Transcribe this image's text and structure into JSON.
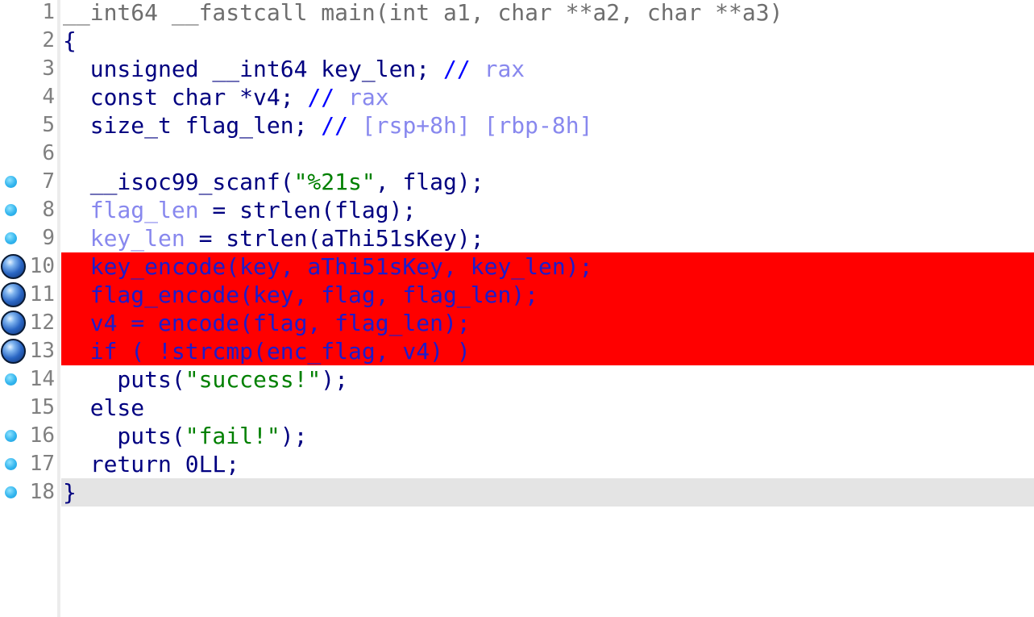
{
  "lines": [
    {
      "n": "1",
      "marker": "none",
      "state": "normal",
      "tokens": [
        {
          "t": "__int64 __fastcall main(int a1, char **a2, char **a3)",
          "c": "gray"
        }
      ]
    },
    {
      "n": "2",
      "marker": "none",
      "state": "normal",
      "tokens": [
        {
          "t": "{",
          "c": "navy"
        }
      ]
    },
    {
      "n": "3",
      "marker": "none",
      "state": "normal",
      "tokens": [
        {
          "t": "  unsigned __int64 key_len; ",
          "c": "navy"
        },
        {
          "t": "// ",
          "c": "blue"
        },
        {
          "t": "rax",
          "c": "light"
        }
      ]
    },
    {
      "n": "4",
      "marker": "none",
      "state": "normal",
      "tokens": [
        {
          "t": "  const char *v4; ",
          "c": "navy"
        },
        {
          "t": "// ",
          "c": "blue"
        },
        {
          "t": "rax",
          "c": "light"
        }
      ]
    },
    {
      "n": "5",
      "marker": "none",
      "state": "normal",
      "tokens": [
        {
          "t": "  size_t flag_len; ",
          "c": "navy"
        },
        {
          "t": "// ",
          "c": "blue"
        },
        {
          "t": "[rsp+8h] [rbp-8h]",
          "c": "light"
        }
      ]
    },
    {
      "n": "6",
      "marker": "none",
      "state": "normal",
      "tokens": [
        {
          "t": "",
          "c": "navy"
        }
      ]
    },
    {
      "n": "7",
      "marker": "dot",
      "state": "normal",
      "tokens": [
        {
          "t": "  __isoc99_scanf(",
          "c": "navy"
        },
        {
          "t": "\"%21s\"",
          "c": "green"
        },
        {
          "t": ", ",
          "c": "navy"
        },
        {
          "t": "flag",
          "c": "navy"
        },
        {
          "t": ");",
          "c": "navy"
        }
      ]
    },
    {
      "n": "8",
      "marker": "dot",
      "state": "normal",
      "tokens": [
        {
          "t": "  ",
          "c": "navy"
        },
        {
          "t": "flag_len",
          "c": "light"
        },
        {
          "t": " = strlen(flag);",
          "c": "navy"
        }
      ]
    },
    {
      "n": "9",
      "marker": "dot",
      "state": "normal",
      "tokens": [
        {
          "t": "  ",
          "c": "navy"
        },
        {
          "t": "key_len",
          "c": "light"
        },
        {
          "t": " = strlen(aThi51sKey);",
          "c": "navy"
        }
      ]
    },
    {
      "n": "10",
      "marker": "breakpoint",
      "state": "breakpoint",
      "tokens": [
        {
          "t": "  key_encode(key, aThi51sKey, key_len);",
          "c": "bp"
        }
      ]
    },
    {
      "n": "11",
      "marker": "breakpoint",
      "state": "breakpoint",
      "tokens": [
        {
          "t": "  flag_encode(key, flag, flag_len);",
          "c": "bp"
        }
      ]
    },
    {
      "n": "12",
      "marker": "breakpoint",
      "state": "breakpoint",
      "tokens": [
        {
          "t": "  v4 = encode(flag, flag_len);",
          "c": "bp"
        }
      ]
    },
    {
      "n": "13",
      "marker": "breakpoint",
      "state": "breakpoint",
      "tokens": [
        {
          "t": "  if ( !strcmp(enc_flag, v4) )",
          "c": "bp"
        }
      ]
    },
    {
      "n": "14",
      "marker": "dot",
      "state": "normal",
      "tokens": [
        {
          "t": "    puts(",
          "c": "navy"
        },
        {
          "t": "\"success!\"",
          "c": "green"
        },
        {
          "t": ");",
          "c": "navy"
        }
      ]
    },
    {
      "n": "15",
      "marker": "none",
      "state": "normal",
      "tokens": [
        {
          "t": "  else",
          "c": "navy"
        }
      ]
    },
    {
      "n": "16",
      "marker": "dot",
      "state": "normal",
      "tokens": [
        {
          "t": "    puts(",
          "c": "navy"
        },
        {
          "t": "\"fail!\"",
          "c": "green"
        },
        {
          "t": ");",
          "c": "navy"
        }
      ]
    },
    {
      "n": "17",
      "marker": "dot",
      "state": "normal",
      "tokens": [
        {
          "t": "  return 0LL;",
          "c": "navy"
        }
      ]
    },
    {
      "n": "18",
      "marker": "dot",
      "state": "current",
      "tokens": [
        {
          "t": "}",
          "c": "navy"
        }
      ]
    }
  ],
  "colors": {
    "breakpoint_line": "#ff0000",
    "current_line": "#e4e4e4",
    "line_number": "#808080",
    "string": "#008000",
    "keyword_text": "#000080",
    "variable_light": "#8888ee"
  }
}
